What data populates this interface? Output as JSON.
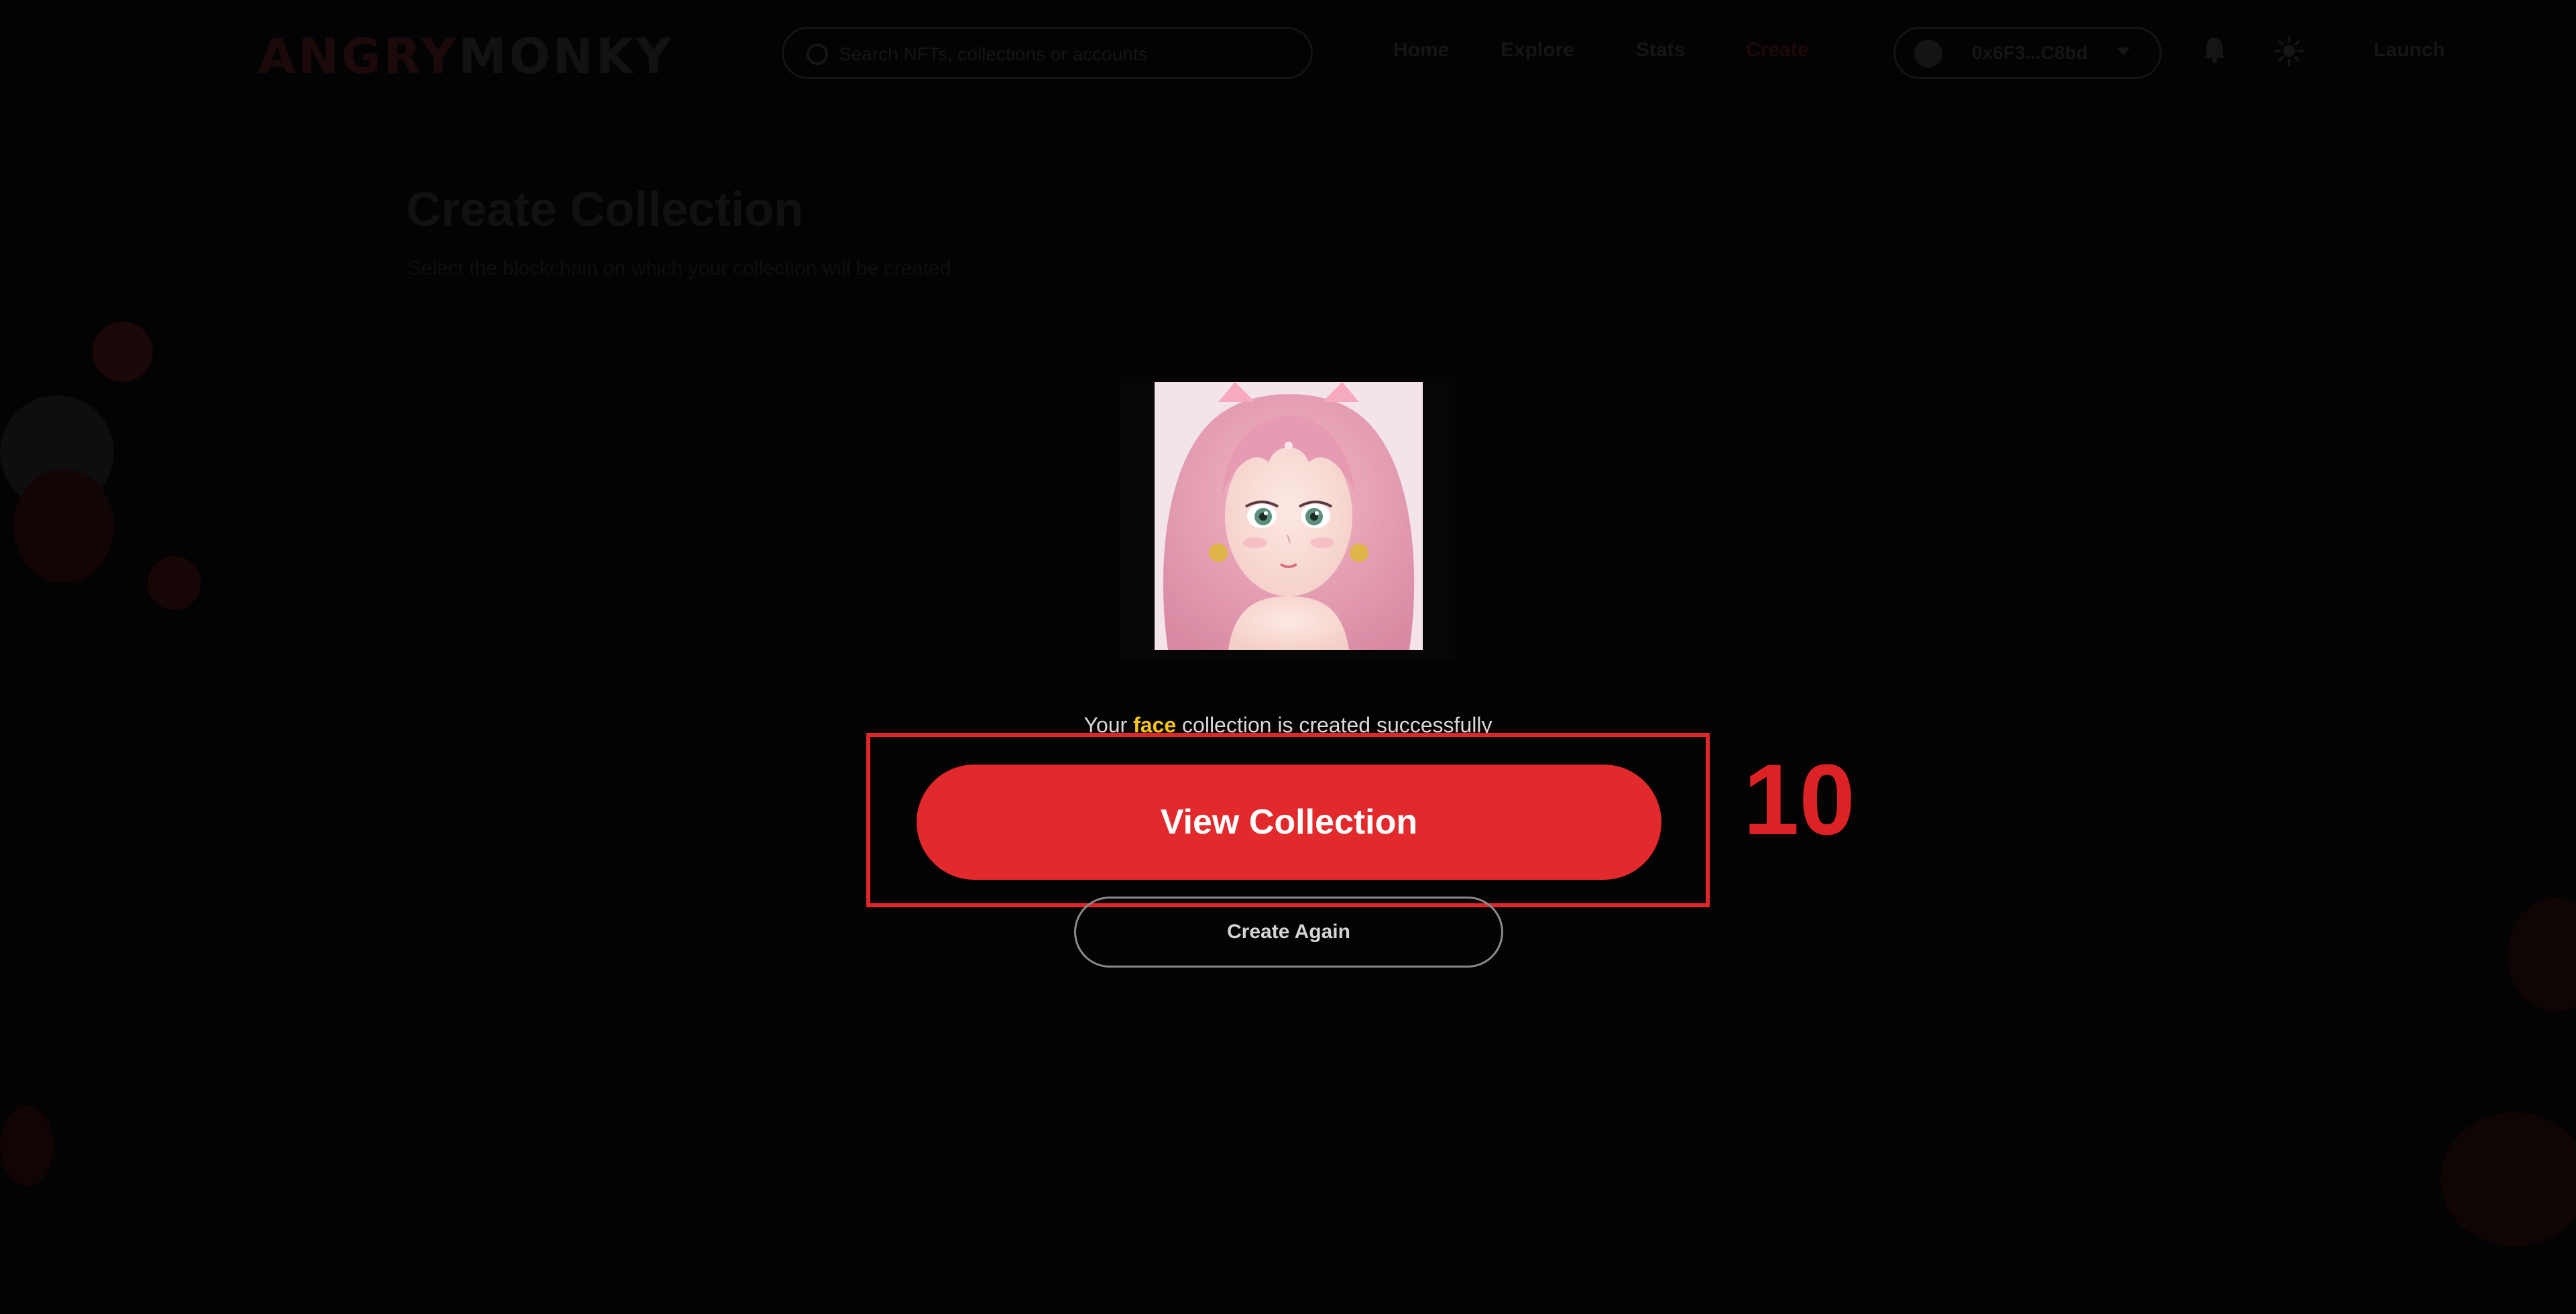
{
  "header": {
    "logo_part1": "ANGRY",
    "logo_part2": "MONKY",
    "search": {
      "placeholder": "Search NFTs, collections or accounts"
    },
    "nav": [
      "Home",
      "Explore",
      "Stats",
      "Create"
    ],
    "wallet_label": "0x6F3...C8bd",
    "launch": "Launch"
  },
  "background_page": {
    "title": "Create Collection",
    "subtitle": "Select the blockchain on which your collection will be created"
  },
  "modal": {
    "message_before": "Your",
    "collection_name": "face",
    "message_after": "collection is created successfully",
    "view_button": "View Collection",
    "create_again_button": "Create Again"
  },
  "annotation": {
    "label": "10"
  },
  "colors": {
    "accent_red": "#e2292c",
    "highlight_yellow": "#f5c518",
    "background": "#030303"
  }
}
